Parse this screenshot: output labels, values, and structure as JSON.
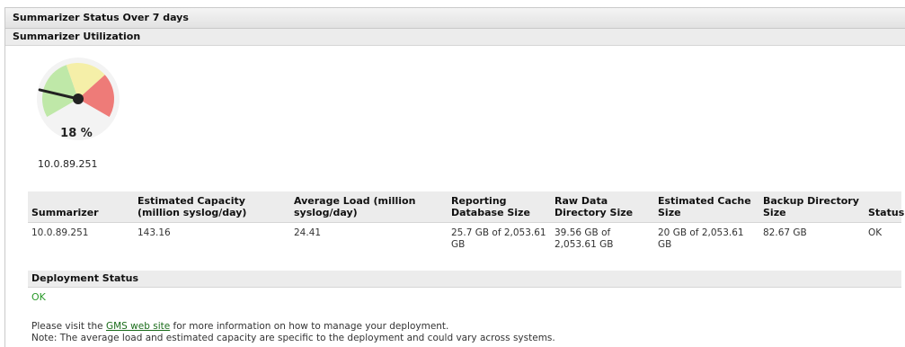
{
  "panel": {
    "title": "Summarizer Status Over 7 days"
  },
  "utilization": {
    "title": "Summarizer Utilization",
    "gauge_value": 18,
    "gauge_label": "18 %",
    "ip": "10.0.89.251",
    "colors": {
      "green": "#bfe8a8",
      "yellow": "#f5efa8",
      "red": "#ee7b78",
      "needle": "#222222"
    }
  },
  "table": {
    "headers": [
      "Summarizer",
      "Estimated Capacity (million syslog/day)",
      "Average Load (million syslog/day)",
      "Reporting Database Size",
      "Raw Data Directory Size",
      "Estimated Cache Size",
      "Backup Directory Size",
      "Status"
    ],
    "rows": [
      [
        "10.0.89.251",
        "143.16",
        "24.41",
        "25.7 GB of 2,053.61 GB",
        "39.56 GB of 2,053.61 GB",
        "20 GB of 2,053.61 GB",
        "82.67 GB",
        "OK"
      ]
    ]
  },
  "deployment": {
    "title": "Deployment Status",
    "status": "OK"
  },
  "notes": {
    "line1_prefix": "Please visit the",
    "link_text": "GMS web site",
    "line1_suffix": "for more information on how to manage your deployment.",
    "line2": "Note: The average load and estimated capacity are specific to the deployment and could vary across systems."
  }
}
